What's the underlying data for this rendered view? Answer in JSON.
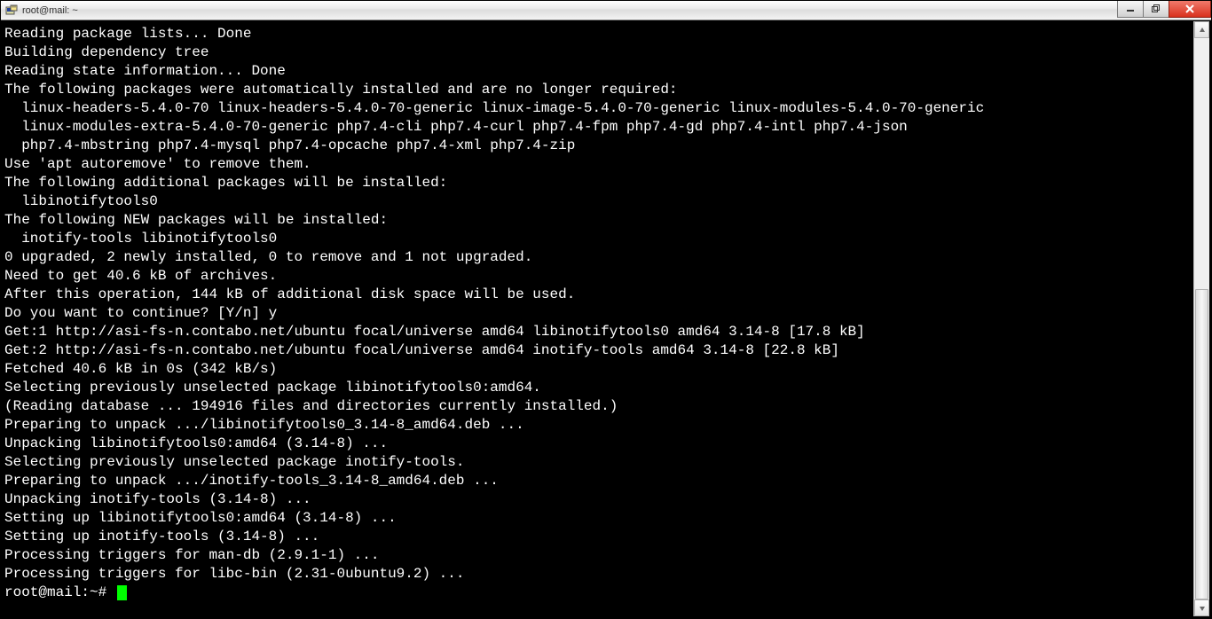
{
  "window": {
    "title": "root@mail: ~"
  },
  "terminal": {
    "lines": [
      "Reading package lists... Done",
      "Building dependency tree",
      "Reading state information... Done",
      "The following packages were automatically installed and are no longer required:",
      "  linux-headers-5.4.0-70 linux-headers-5.4.0-70-generic linux-image-5.4.0-70-generic linux-modules-5.4.0-70-generic",
      "  linux-modules-extra-5.4.0-70-generic php7.4-cli php7.4-curl php7.4-fpm php7.4-gd php7.4-intl php7.4-json",
      "  php7.4-mbstring php7.4-mysql php7.4-opcache php7.4-xml php7.4-zip",
      "Use 'apt autoremove' to remove them.",
      "The following additional packages will be installed:",
      "  libinotifytools0",
      "The following NEW packages will be installed:",
      "  inotify-tools libinotifytools0",
      "0 upgraded, 2 newly installed, 0 to remove and 1 not upgraded.",
      "Need to get 40.6 kB of archives.",
      "After this operation, 144 kB of additional disk space will be used.",
      "Do you want to continue? [Y/n] y",
      "Get:1 http://asi-fs-n.contabo.net/ubuntu focal/universe amd64 libinotifytools0 amd64 3.14-8 [17.8 kB]",
      "Get:2 http://asi-fs-n.contabo.net/ubuntu focal/universe amd64 inotify-tools amd64 3.14-8 [22.8 kB]",
      "Fetched 40.6 kB in 0s (342 kB/s)",
      "Selecting previously unselected package libinotifytools0:amd64.",
      "(Reading database ... 194916 files and directories currently installed.)",
      "Preparing to unpack .../libinotifytools0_3.14-8_amd64.deb ...",
      "Unpacking libinotifytools0:amd64 (3.14-8) ...",
      "Selecting previously unselected package inotify-tools.",
      "Preparing to unpack .../inotify-tools_3.14-8_amd64.deb ...",
      "Unpacking inotify-tools (3.14-8) ...",
      "Setting up libinotifytools0:amd64 (3.14-8) ...",
      "Setting up inotify-tools (3.14-8) ...",
      "Processing triggers for man-db (2.9.1-1) ...",
      "Processing triggers for libc-bin (2.31-0ubuntu9.2) ..."
    ],
    "prompt": "root@mail:~# "
  },
  "icons": {
    "putty": "putty-icon",
    "minimize": "minimize-icon",
    "maximize": "maximize-icon",
    "close": "close-icon",
    "scroll_up": "scroll-up-icon",
    "scroll_down": "scroll-down-icon"
  }
}
